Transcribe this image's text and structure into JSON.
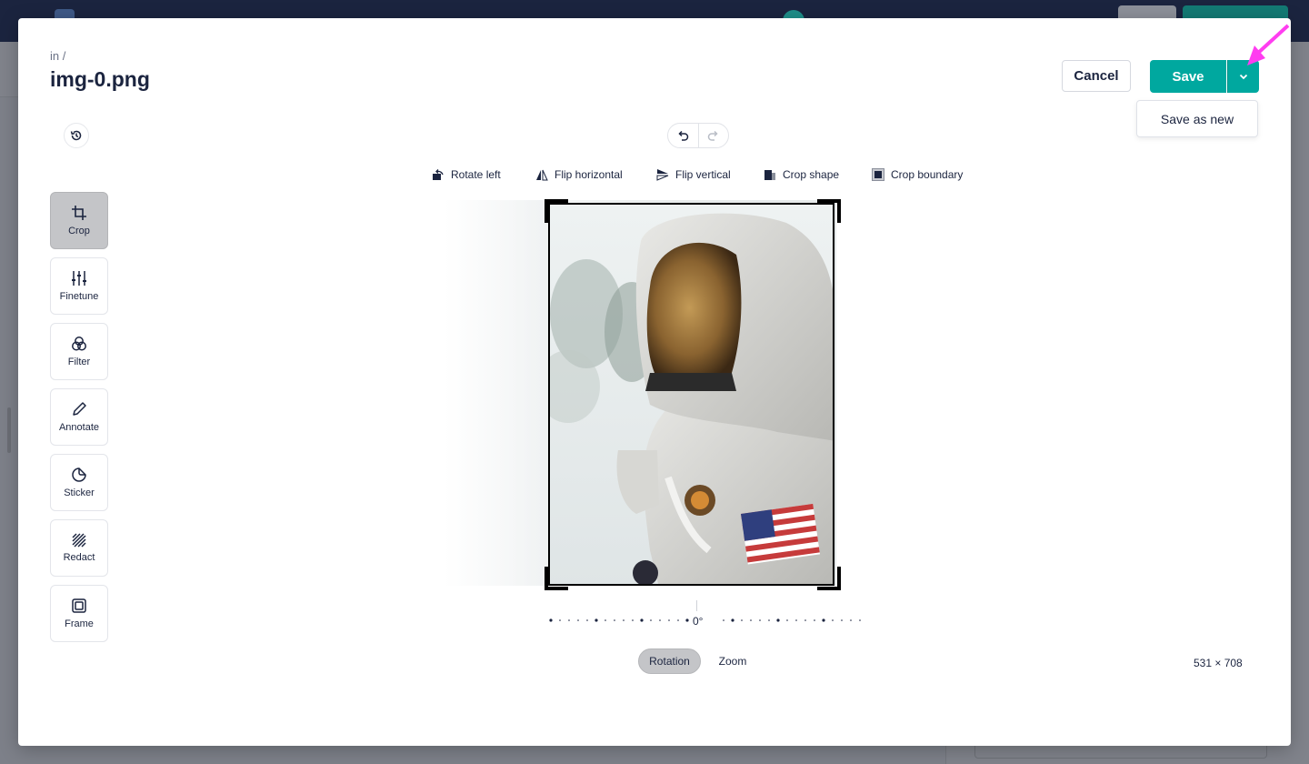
{
  "header": {
    "breadcrumb": "in /",
    "file_name": "img-0.png",
    "cancel_label": "Cancel",
    "save_label": "Save",
    "save_menu": [
      "Save as new"
    ]
  },
  "tools": [
    {
      "label": "Crop",
      "icon": "crop-icon",
      "active": true
    },
    {
      "label": "Finetune",
      "icon": "sliders-icon",
      "active": false
    },
    {
      "label": "Filter",
      "icon": "filter-circles-icon",
      "active": false
    },
    {
      "label": "Annotate",
      "icon": "pencil-icon",
      "active": false
    },
    {
      "label": "Sticker",
      "icon": "sticker-icon",
      "active": false
    },
    {
      "label": "Redact",
      "icon": "redact-hatch-icon",
      "active": false
    },
    {
      "label": "Frame",
      "icon": "frame-icon",
      "active": false
    }
  ],
  "toolbar": {
    "rotate_left": "Rotate left",
    "flip_horizontal": "Flip horizontal",
    "flip_vertical": "Flip vertical",
    "crop_shape": "Crop shape",
    "crop_boundary": "Crop boundary"
  },
  "rotation": {
    "value_label": "0°"
  },
  "tabs": {
    "rotation": "Rotation",
    "zoom": "Zoom",
    "active": "Rotation"
  },
  "image_size": "531 × 708",
  "colors": {
    "accent": "#00a89f",
    "active_tool": "#c4c5c8",
    "annotation_arrow": "#ff3df0"
  }
}
